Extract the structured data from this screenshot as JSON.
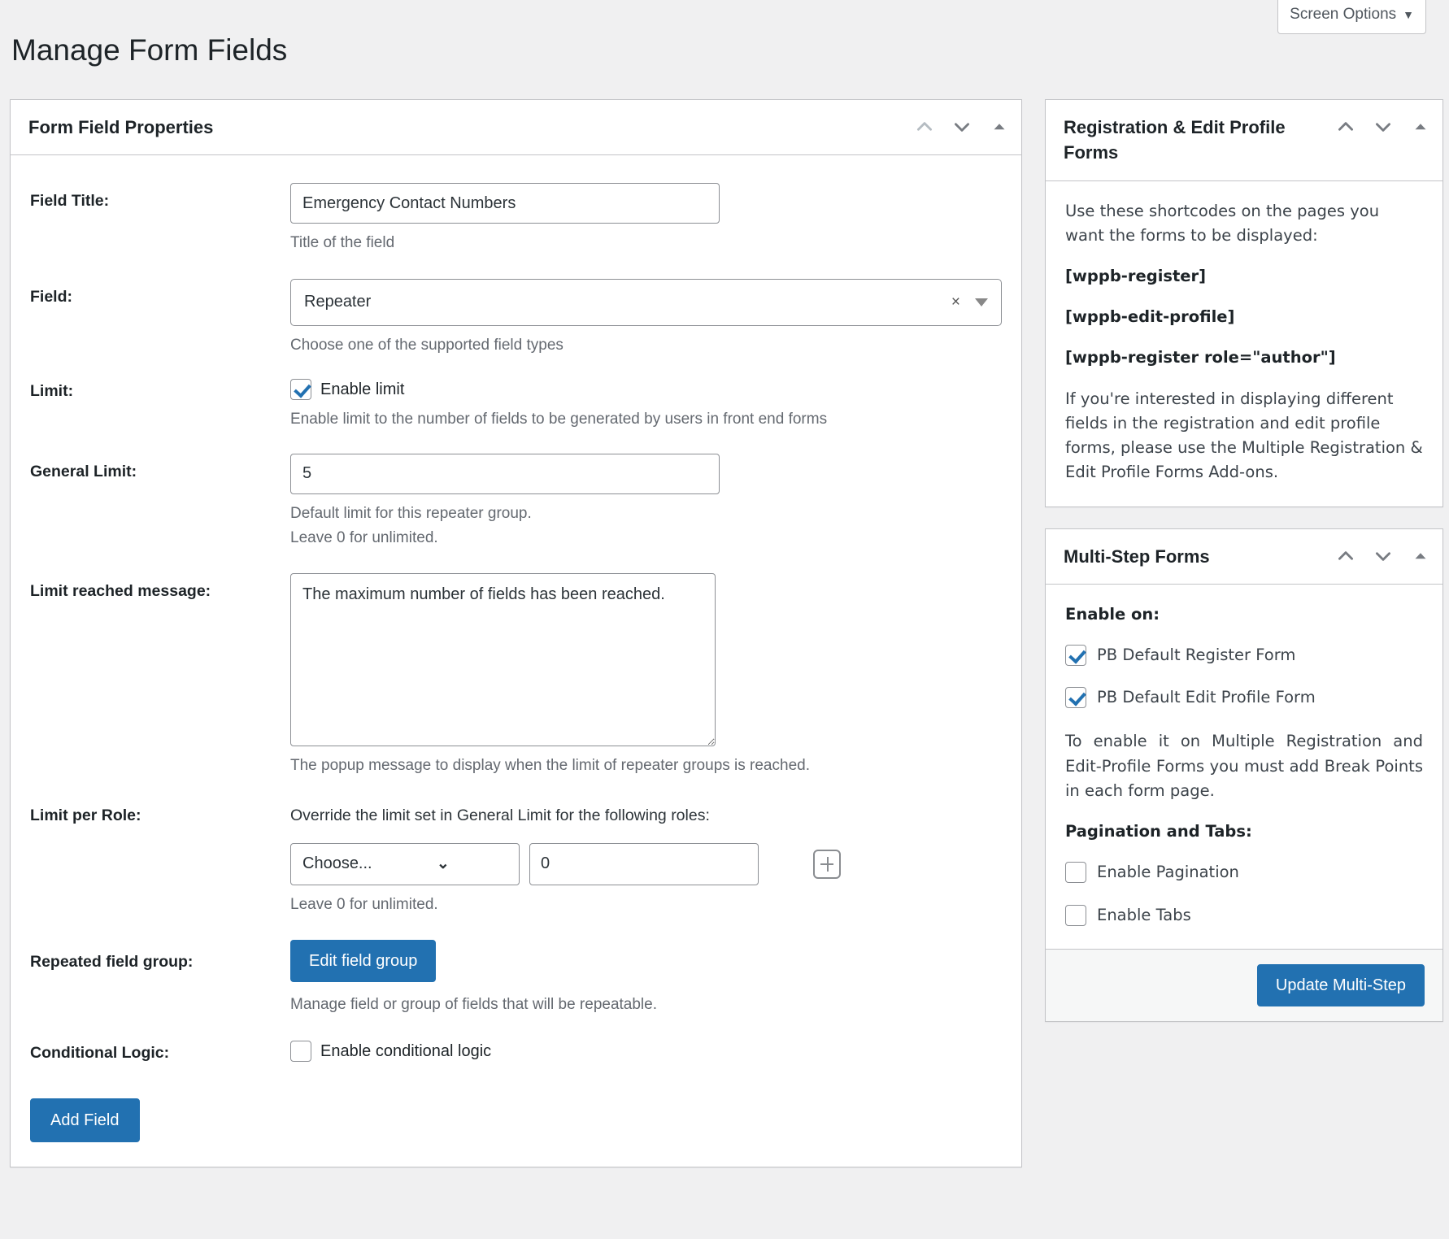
{
  "screen_options": {
    "label": "Screen Options",
    "caret": "chevron-down"
  },
  "page": {
    "title": "Manage Form Fields"
  },
  "main_panel": {
    "title": "Form Field Properties",
    "actions": {
      "move_up": "chevron-up-icon",
      "move_down": "chevron-down-icon",
      "toggle": "toggle-triangle-icon"
    },
    "rows": {
      "field_title": {
        "label": "Field Title:",
        "value": "Emergency Contact Numbers",
        "placeholder": "",
        "description": "Title of the field"
      },
      "field_type": {
        "label": "Field:",
        "value": "Repeater",
        "clear": "×",
        "description": "Choose one of the supported field types"
      },
      "limit": {
        "label": "Limit:",
        "checkbox_label": "Enable limit",
        "checked": true,
        "description": "Enable limit to the number of fields to be generated by users in front end forms"
      },
      "general_limit": {
        "label": "General Limit:",
        "value": "5",
        "description_line1": "Default limit for this repeater group.",
        "description_line2": "Leave 0 for unlimited."
      },
      "limit_reached_message": {
        "label": "Limit reached message:",
        "value": "The maximum number of fields has been reached.",
        "description": "The popup message to display when the limit of repeater groups is reached."
      },
      "limit_per_role": {
        "label": "Limit per Role:",
        "intro": "Override the limit set in General Limit for the following roles:",
        "role_select_value": "Choose...",
        "role_limit_value": "0",
        "add_button": "plus-icon",
        "description": "Leave 0 for unlimited."
      },
      "repeated_field_group": {
        "label": "Repeated field group:",
        "button": "Edit field group",
        "description": "Manage field or group of fields that will be repeatable."
      },
      "conditional_logic": {
        "label": "Conditional Logic:",
        "checkbox_label": "Enable conditional logic",
        "checked": false
      }
    },
    "add_field_button": "Add Field"
  },
  "sidebar": {
    "registration_panel": {
      "title": "Registration & Edit Profile Forms",
      "intro": "Use these shortcodes on the pages you want the forms to be displayed:",
      "shortcodes": [
        "[wppb-register]",
        "[wppb-edit-profile]",
        "[wppb-register role=\"author\"]"
      ],
      "note": "If you're interested in displaying different fields in the registration and edit profile forms, please use the Multiple Registration & Edit Profile Forms Add-ons."
    },
    "multistep_panel": {
      "title": "Multi-Step Forms",
      "enable_on_label": "Enable on:",
      "options": [
        {
          "label": "PB Default Register Form",
          "checked": true
        },
        {
          "label": "PB Default Edit Profile Form",
          "checked": true
        }
      ],
      "note": "To enable it on Multiple Registration and Edit-Profile Forms you must add Break Points in each form page.",
      "pagination_label": "Pagination and Tabs:",
      "pagination_options": [
        {
          "label": "Enable Pagination",
          "checked": false
        },
        {
          "label": "Enable Tabs",
          "checked": false
        }
      ],
      "update_button": "Update Multi-Step"
    }
  },
  "colors": {
    "primary": "#2271b1",
    "page_bg": "#f0f0f1",
    "border": "#c3c4c7",
    "text": "#1d2327",
    "muted": "#646970"
  }
}
